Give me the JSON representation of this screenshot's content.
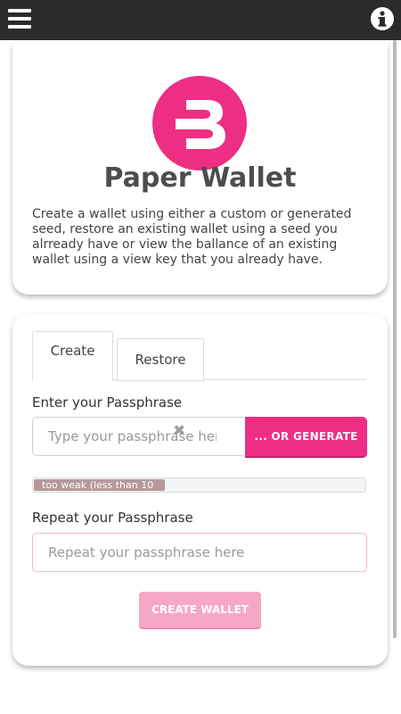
{
  "header": {
    "menu_icon": "hamburger-menu-icon",
    "info_icon": "info-icon"
  },
  "intro": {
    "logo_icon": "bytecoin-logo",
    "title": "Paper Wallet",
    "description": "Create a wallet using either a custom or generated seed, restore an existing wallet using a seed you alrready have or view the ballance of an existing wallet using a view key that you already have."
  },
  "form": {
    "tabs": [
      {
        "label": "Create",
        "active": true
      },
      {
        "label": "Restore",
        "active": false
      }
    ],
    "passphrase_label": "Enter your Passphrase",
    "passphrase_placeholder": "Type your passphrase here",
    "generate_label": "... OR GENERATE",
    "strength": {
      "text": "too weak (less than 10",
      "level_percent": 40
    },
    "repeat_label": "Repeat your Passphrase",
    "repeat_placeholder": "Repeat your passphrase here",
    "create_label": "CREATE WALLET"
  },
  "colors": {
    "accent": "#ed2e83",
    "accent_disabled": "#f6a7c8",
    "topbar": "#2b2b2b"
  }
}
